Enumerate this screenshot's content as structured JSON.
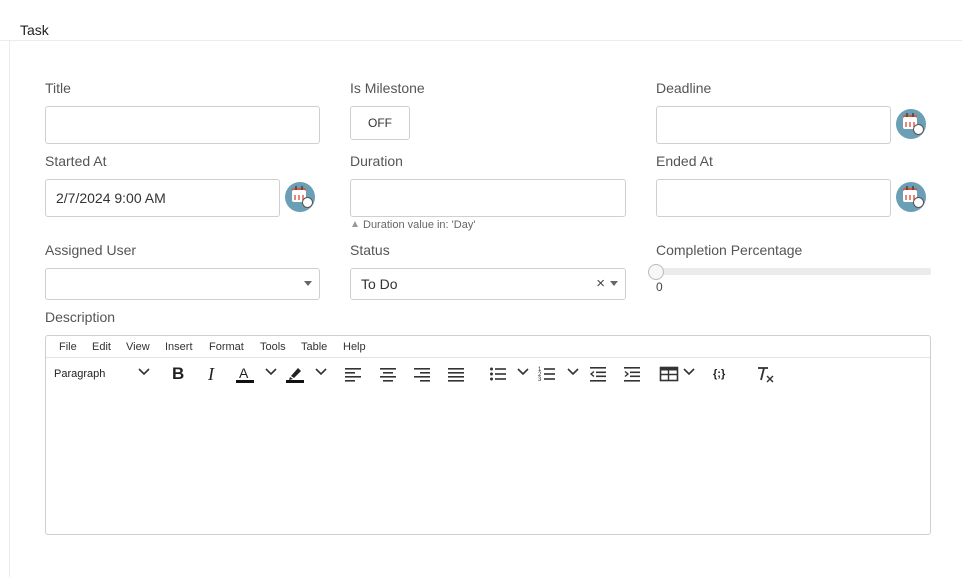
{
  "header": {
    "title": "Task"
  },
  "form": {
    "title_label": "Title",
    "title_value": "",
    "milestone_label": "Is Milestone",
    "milestone_toggle": "OFF",
    "deadline_label": "Deadline",
    "deadline_value": "",
    "started_label": "Started At",
    "started_value": "2/7/2024 9:00 AM",
    "duration_label": "Duration",
    "duration_value": "",
    "duration_hint": "Duration value in: 'Day'",
    "ended_label": "Ended At",
    "ended_value": "",
    "assigned_label": "Assigned User",
    "assigned_value": "",
    "status_label": "Status",
    "status_value": "To Do",
    "status_clear": "×",
    "completion_label": "Completion Percentage",
    "completion_value": "0",
    "completion_fraction": 0,
    "description_label": "Description"
  },
  "editor": {
    "menu": [
      "File",
      "Edit",
      "View",
      "Insert",
      "Format",
      "Tools",
      "Table",
      "Help"
    ],
    "block_format": "Paragraph",
    "bold_glyph": "B",
    "italic_glyph": "I",
    "code_glyph": "{;}",
    "content": ""
  },
  "colors": {
    "calendar_button": "#6a9fb5",
    "calendar_accent": "#e0533d",
    "border": "#cfcfcf"
  },
  "icons": [
    "calendar-icon",
    "chevron-down-icon",
    "bold-icon",
    "italic-icon",
    "text-color-icon",
    "highlight-icon",
    "align-left-icon",
    "align-center-icon",
    "align-right-icon",
    "align-justify-icon",
    "bullet-list-icon",
    "numbered-list-icon",
    "outdent-icon",
    "indent-icon",
    "table-icon",
    "code-sample-icon",
    "clear-format-icon"
  ]
}
